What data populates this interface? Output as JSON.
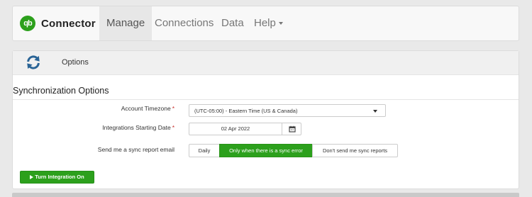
{
  "brand": {
    "logo_text": "qb",
    "name": "Connector",
    "logo_color": "#2ca01c"
  },
  "nav": {
    "items": [
      {
        "label": "Manage",
        "active": true
      },
      {
        "label": "Connections"
      },
      {
        "label": "Data"
      },
      {
        "label": "Help"
      }
    ]
  },
  "panel": {
    "header_title": "Options",
    "section_title": "Synchronization Options",
    "timezone": {
      "label": "Account Timezone",
      "required_mark": "*",
      "value": "(UTC-05:00) - Eastern Time (US & Canada)"
    },
    "start_date": {
      "label": "Integrations Starting Date",
      "required_mark": "*",
      "value": "02 Apr 2022"
    },
    "sync_email": {
      "label": "Send me a sync report email",
      "options": [
        "Daily",
        "Only when there is a sync error",
        "Don't send me sync reports"
      ],
      "selected": "Only when there is a sync error"
    },
    "turn_on_label": "Turn Integration On"
  },
  "colors": {
    "accent": "#2ca01c",
    "icon_blue": "#2a6496"
  }
}
